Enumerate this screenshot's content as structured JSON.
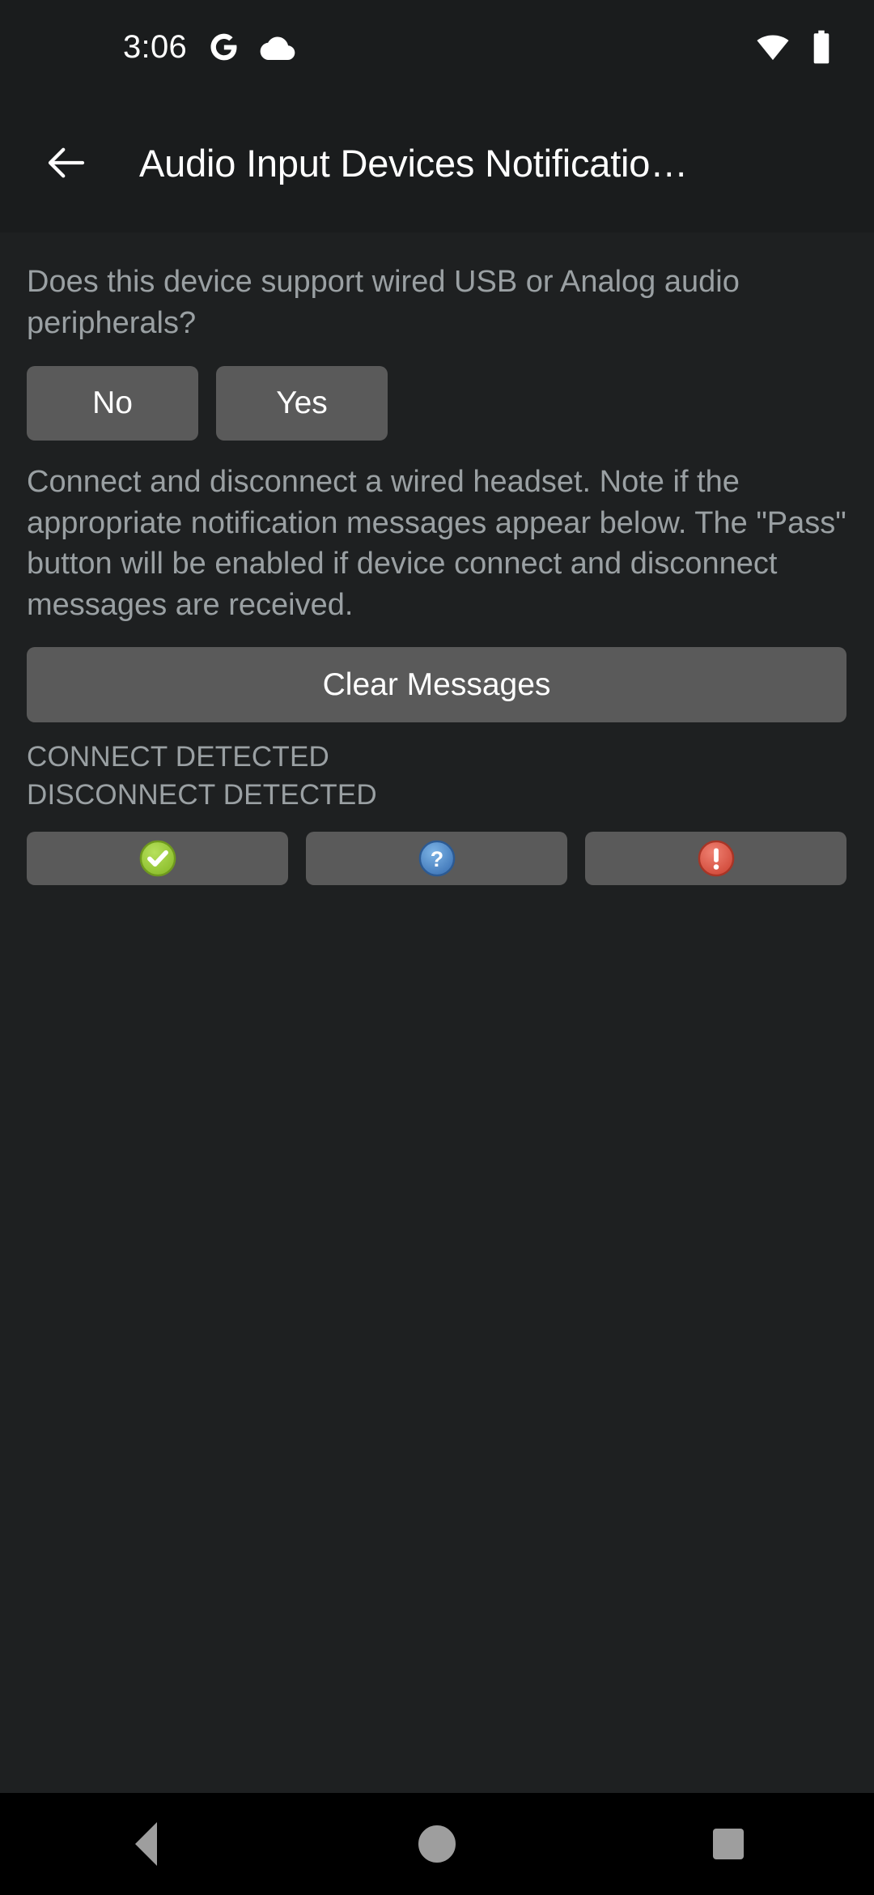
{
  "status_bar": {
    "time": "3:06",
    "icons_left": [
      "google-g-icon",
      "cloud-icon"
    ],
    "icons_right": [
      "wifi-icon",
      "battery-full-icon"
    ]
  },
  "app_bar": {
    "back_icon": "back-arrow-icon",
    "title": "Audio Input Devices Notificatio…"
  },
  "main": {
    "question": "Does this device support wired USB or Analog audio peripherals?",
    "answer_buttons": [
      {
        "label": "No"
      },
      {
        "label": "Yes"
      }
    ],
    "instruction": "Connect and disconnect a wired headset. Note if the appropriate notification messages appear below. The \"Pass\" button will be enabled if device connect and disconnect messages are received.",
    "clear_button_label": "Clear Messages",
    "status_messages": [
      "CONNECT DETECTED",
      "DISCONNECT DETECTED"
    ],
    "verdict_buttons": [
      {
        "icon": "pass-check-icon",
        "color": "#9acd32"
      },
      {
        "icon": "info-question-icon",
        "color": "#4a86c8"
      },
      {
        "icon": "fail-exclamation-icon",
        "color": "#e05a4a"
      }
    ]
  },
  "nav_bar": {
    "buttons": [
      "back-triangle-icon",
      "home-circle-icon",
      "recents-square-icon"
    ]
  },
  "colors": {
    "background": "#1e2021",
    "app_bar": "#1a1c1d",
    "button": "#5a5a5a",
    "text_primary": "#ffffff",
    "text_secondary": "#9aa0a3",
    "nav_bar": "#000000",
    "nav_icon": "#9e9e9e"
  }
}
